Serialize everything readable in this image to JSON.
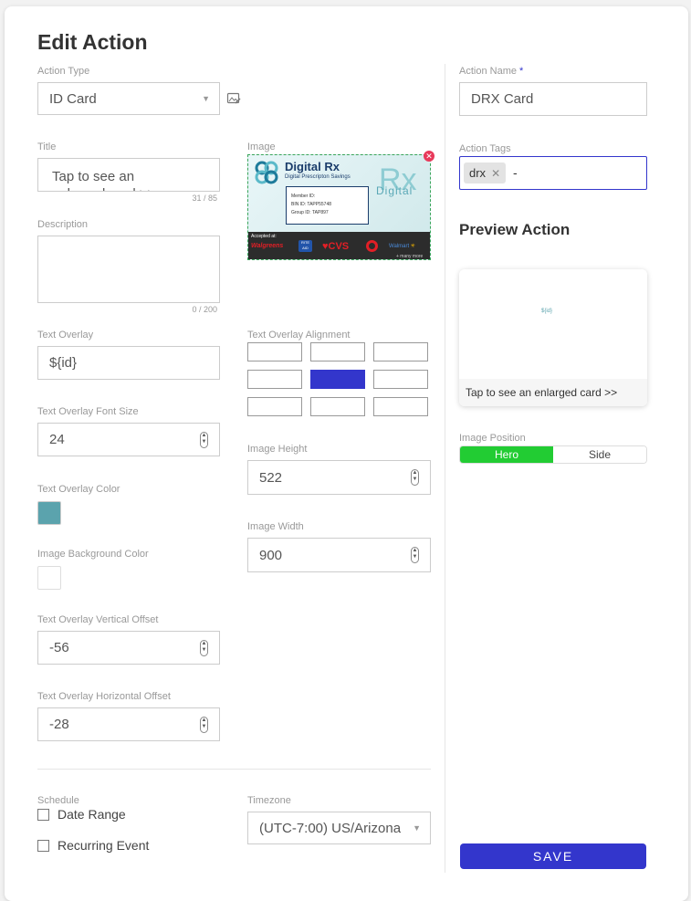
{
  "page": {
    "title": "Edit Action"
  },
  "action_type": {
    "label": "Action Type",
    "value": "ID Card"
  },
  "title_field": {
    "label": "Title",
    "value": "Tap to see an enlarged card >>",
    "count": "31 / 85"
  },
  "image": {
    "label": "Image",
    "card": {
      "brand": "Digital Rx",
      "subtitle": "Digital Prescripton Savings",
      "member_id": "Member ID:",
      "bin_id": "BIN ID: TAPP55748",
      "group_id": "Group ID: TAP897",
      "watermark_rx": "Rx",
      "watermark_digital": "Digital",
      "accepted": "Accepted at:",
      "pharmacies": [
        "Walgreens",
        "RITE AID",
        "CVS",
        "Target",
        "Walmart"
      ],
      "more": "+ many more"
    }
  },
  "description": {
    "label": "Description",
    "value": "",
    "count": "0 / 200"
  },
  "text_overlay": {
    "label": "Text Overlay",
    "value": "${id}"
  },
  "text_overlay_alignment": {
    "label": "Text Overlay Alignment",
    "selected_index": 4
  },
  "text_overlay_font_size": {
    "label": "Text Overlay Font Size",
    "value": "24"
  },
  "image_height": {
    "label": "Image Height",
    "value": "522"
  },
  "text_overlay_color": {
    "label": "Text Overlay Color",
    "color": "#5ba3ad"
  },
  "image_width": {
    "label": "Image Width",
    "value": "900"
  },
  "image_background_color": {
    "label": "Image Background Color",
    "color": "#ffffff"
  },
  "vertical_offset": {
    "label": "Text Overlay Vertical Offset",
    "value": "-56"
  },
  "horizontal_offset": {
    "label": "Text Overlay Horizontal Offset",
    "value": "-28"
  },
  "schedule": {
    "label": "Schedule",
    "date_range": "Date Range",
    "recurring_event": "Recurring Event"
  },
  "timezone": {
    "label": "Timezone",
    "value": "(UTC-7:00) US/Arizona"
  },
  "action_name": {
    "label": "Action Name",
    "required_mark": "*",
    "value": "DRX Card"
  },
  "action_tags": {
    "label": "Action Tags",
    "tags": [
      "drx"
    ],
    "input_value": "-"
  },
  "preview": {
    "heading": "Preview Action",
    "overlay_text": "${id}",
    "caption": "Tap to see an enlarged card >>"
  },
  "image_position": {
    "label": "Image Position",
    "options": [
      "Hero",
      "Side"
    ],
    "selected": "Hero"
  },
  "save_label": "SAVE",
  "colors": {
    "accent": "#3336cc",
    "hero_green": "#22cc33",
    "required": "#3336cc",
    "remove_red": "#e8395a"
  }
}
